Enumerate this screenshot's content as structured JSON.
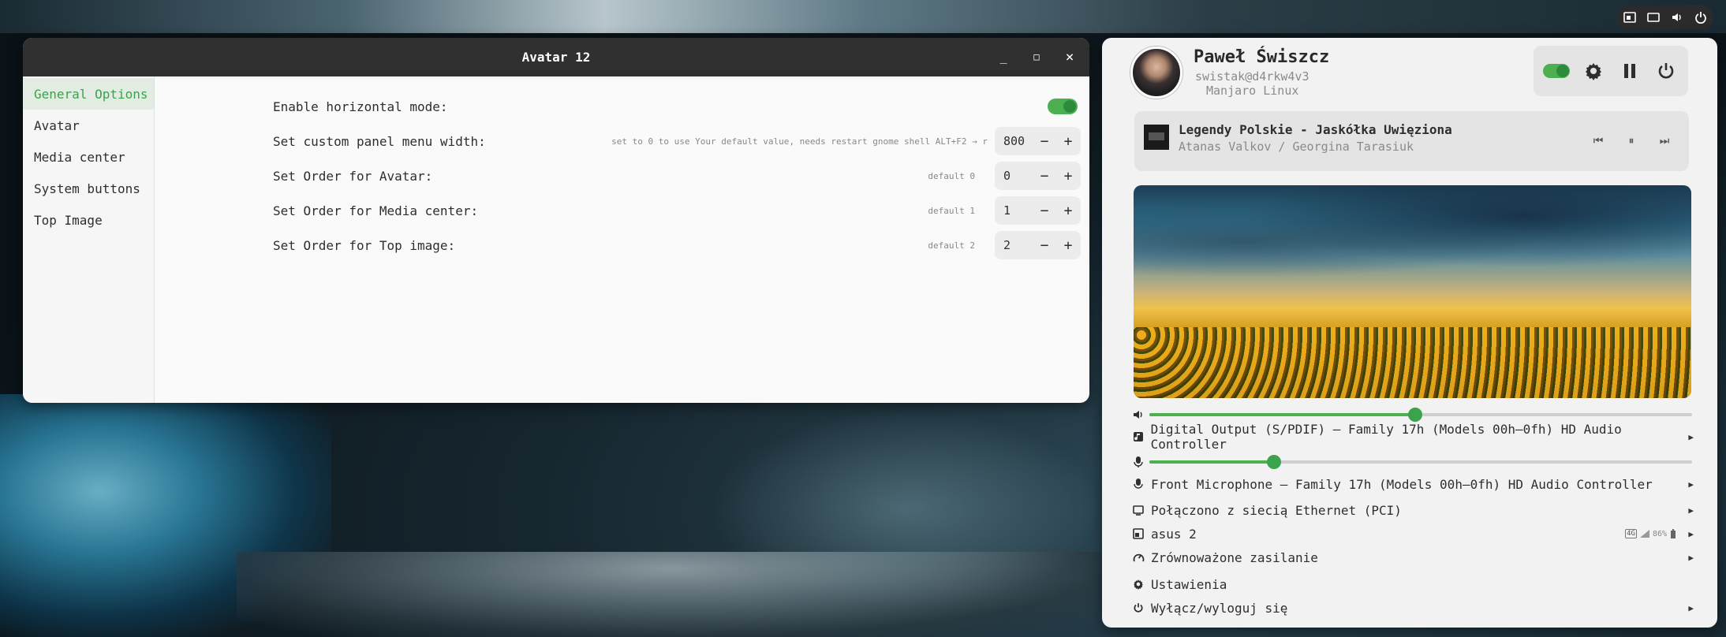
{
  "top_bar": {
    "icons": [
      "screen-share-icon",
      "display-icon",
      "volume-icon",
      "power-icon"
    ]
  },
  "window": {
    "title": "Avatar 12",
    "controls": {
      "minimize": "_",
      "maximize": "□",
      "close": "×"
    },
    "sidebar": [
      {
        "label": "General Options",
        "active": true
      },
      {
        "label": "Avatar"
      },
      {
        "label": "Media center"
      },
      {
        "label": "System buttons"
      },
      {
        "label": "Top Image"
      }
    ],
    "settings": {
      "horizontal": {
        "label": "Enable horizontal mode:",
        "enabled": true
      },
      "width": {
        "label": "Set custom panel menu width:",
        "hint": "set to 0 to use Your default value, needs restart gnome shell ALT+F2 → r",
        "value": "800"
      },
      "order_avatar": {
        "label": "Set Order for Avatar:",
        "hint": "default 0",
        "value": "0"
      },
      "order_media": {
        "label": "Set Order for Media center:",
        "hint": "default 1",
        "value": "1"
      },
      "order_top": {
        "label": "Set Order for Top image:",
        "hint": "default 2",
        "value": "2"
      }
    },
    "spin_minus": "−",
    "spin_plus": "+"
  },
  "panel": {
    "user": {
      "name": "Paweł Świszcz",
      "host": "swistak@d4rkw4v3",
      "distro": "Manjaro Linux"
    },
    "system_buttons": [
      "toggle",
      "gear-icon",
      "pause-icon",
      "power-icon"
    ],
    "media": {
      "title": "Legendy Polskie - Jaskółka Uwięziona",
      "artist": "Atanas Valkov / Georgina Tarasiuk",
      "prev": "⏮",
      "pause": "⏸",
      "next": "⏭"
    },
    "volume": {
      "output_level": 0.49,
      "input_level": 0.23
    },
    "items": {
      "output": "Digital Output (S/PDIF) – Family 17h (Models 00h–0fh) HD Audio Controller",
      "input": "Front Microphone – Family 17h (Models 00h–0fh) HD Audio Controller",
      "ethernet": "Połączono z siecią Ethernet (PCI)",
      "device": "asus 2",
      "device_battery": "86%",
      "device_signal": "4G",
      "power": "Zrównoważone zasilanie",
      "settings": "Ustawienia",
      "logout": "Wyłącz/wyloguj się"
    },
    "arrow": "▶"
  },
  "colors": {
    "accent": "#4caf50",
    "titlebar": "#303030",
    "panel_bg": "#f2f2f2"
  }
}
